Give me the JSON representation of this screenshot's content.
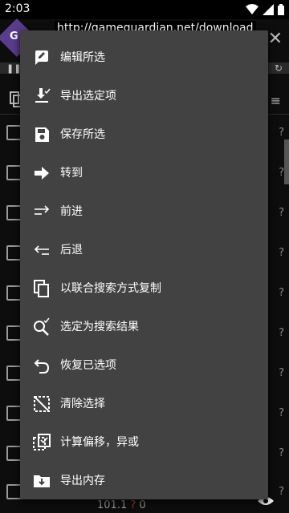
{
  "status_bar": {
    "time": "2:03"
  },
  "background": {
    "url": "http://gameguardian.net/download",
    "bottom_value": "101.1",
    "bottom_suffix": "0"
  },
  "menu": {
    "items": [
      {
        "label": "编辑所选",
        "icon": "edit-icon"
      },
      {
        "label": "导出选定项",
        "icon": "export-icon"
      },
      {
        "label": "保存所选",
        "icon": "save-icon"
      },
      {
        "label": "转到",
        "icon": "arrow-right-icon"
      },
      {
        "label": "前进",
        "icon": "forward-icon"
      },
      {
        "label": "后退",
        "icon": "back-icon"
      },
      {
        "label": "以联合搜索方式复制",
        "icon": "copy-icon"
      },
      {
        "label": "选定为搜索结果",
        "icon": "search-check-icon"
      },
      {
        "label": "恢复已选项",
        "icon": "undo-icon"
      },
      {
        "label": "清除选择",
        "icon": "clear-selection-icon"
      },
      {
        "label": "计算偏移，异或",
        "icon": "calculate-icon"
      },
      {
        "label": "导出内存",
        "icon": "export-memory-icon"
      }
    ]
  }
}
